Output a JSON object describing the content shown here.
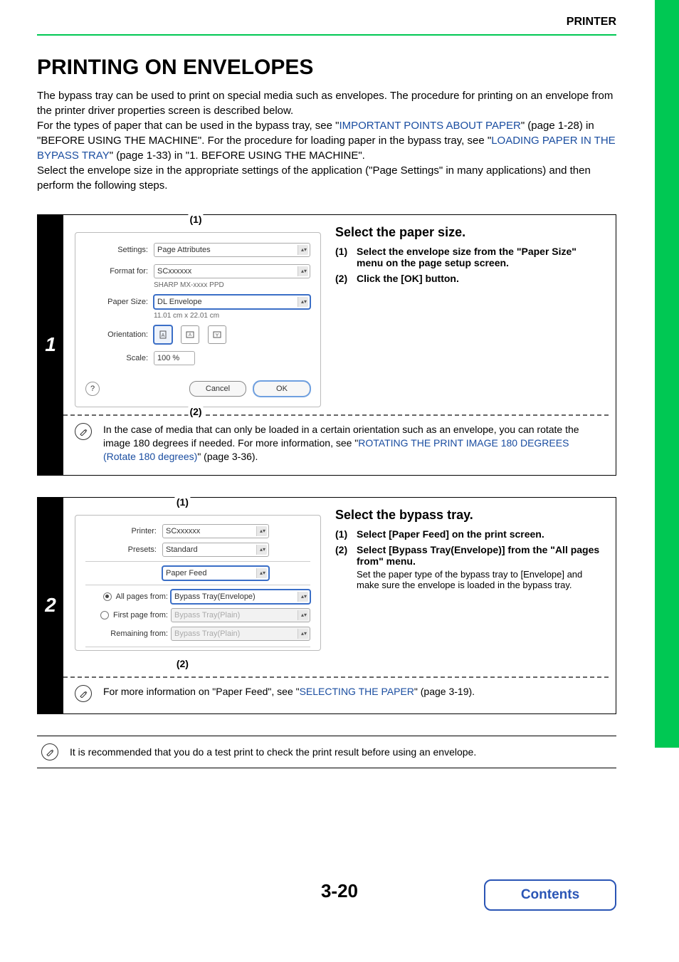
{
  "header": {
    "section": "PRINTER"
  },
  "title": "PRINTING ON ENVELOPES",
  "intro": {
    "p1": "The bypass tray can be used to print on special media such as envelopes. The procedure for printing on an envelope from the printer driver properties screen is described below.",
    "p2a": "For the types of paper that can be used in the bypass tray, see \"",
    "link1": "IMPORTANT POINTS ABOUT PAPER",
    "p2b": "\" (page 1-28) in \"BEFORE USING THE MACHINE\". For the procedure for loading paper in the bypass tray, see \"",
    "link2": "LOADING PAPER IN THE BYPASS TRAY",
    "p2c": "\" (page 1-33) in \"1. BEFORE USING THE MACHINE\".",
    "p3": "Select the envelope size in the appropriate settings of the application (\"Page Settings\" in many applications) and then perform the following steps."
  },
  "step1": {
    "num": "1",
    "callout1": "(1)",
    "callout2": "(2)",
    "dlg": {
      "settings_label": "Settings:",
      "settings_value": "Page Attributes",
      "format_label": "Format for:",
      "format_value": "SCxxxxxx",
      "format_sub": "SHARP MX-xxxx PPD",
      "papersize_label": "Paper Size:",
      "papersize_value": "DL Envelope",
      "papersize_sub": "11.01 cm x 22.01 cm",
      "orientation_label": "Orientation:",
      "scale_label": "Scale:",
      "scale_value": "100 %",
      "help": "?",
      "cancel": "Cancel",
      "ok": "OK"
    },
    "right": {
      "heading": "Select the paper size.",
      "i1n": "(1)",
      "i1t": "Select the envelope size from the \"Paper Size\" menu on the page setup screen.",
      "i2n": "(2)",
      "i2t": "Click the [OK] button."
    },
    "note": {
      "a": "In the case of media that can only be loaded in a certain orientation such as an envelope, you can rotate the image 180 degrees if needed. For more information, see \"",
      "link": "ROTATING THE PRINT IMAGE 180 DEGREES (Rotate 180 degrees)",
      "b": "\" (page 3-36)."
    }
  },
  "step2": {
    "num": "2",
    "callout1": "(1)",
    "callout2": "(2)",
    "dlg": {
      "printer_label": "Printer:",
      "printer_value": "SCxxxxxx",
      "presets_label": "Presets:",
      "presets_value": "Standard",
      "panel_value": "Paper Feed",
      "allpages_label": "All pages from:",
      "allpages_value": "Bypass Tray(Envelope)",
      "firstpage_label": "First page from:",
      "firstpage_value": "Bypass Tray(Plain)",
      "remaining_label": "Remaining from:",
      "remaining_value": "Bypass Tray(Plain)"
    },
    "right": {
      "heading": "Select the bypass tray.",
      "i1n": "(1)",
      "i1t": "Select [Paper Feed] on the print screen.",
      "i2n": "(2)",
      "i2t": "Select [Bypass Tray(Envelope)] from the \"All pages from\" menu.",
      "i2s": "Set the paper type of the bypass tray to [Envelope] and make sure the envelope is loaded in the bypass tray."
    },
    "note": {
      "a": "For more information on \"Paper Feed\", see \"",
      "link": "SELECTING THE PAPER",
      "b": "\" (page 3-19)."
    }
  },
  "finalnote": "It is recommended that you do a test print to check the print result before using an envelope.",
  "footer": {
    "pagenum": "3-20",
    "contents": "Contents"
  }
}
